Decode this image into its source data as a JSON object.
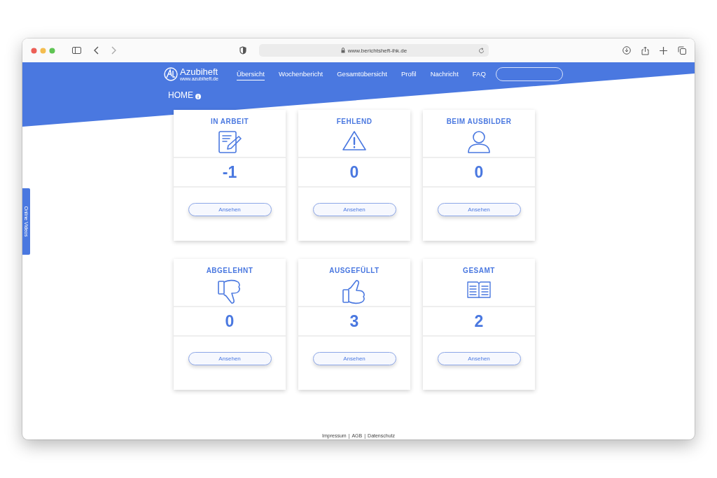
{
  "browser": {
    "url": "www.berichtsheft-ihk.de"
  },
  "header": {
    "logo_title": "Azubiheft",
    "logo_subtitle": "www.azubiheft.de",
    "nav": [
      {
        "label": "Übersicht",
        "selected": true
      },
      {
        "label": "Wochenbericht",
        "selected": false
      },
      {
        "label": "Gesamtübersicht",
        "selected": false
      },
      {
        "label": "Profil",
        "selected": false
      },
      {
        "label": "Nachricht",
        "selected": false
      },
      {
        "label": "FAQ",
        "selected": false
      }
    ],
    "page_title": "HOME"
  },
  "side_tab": {
    "label": "Online Videos"
  },
  "cards": [
    {
      "title": "IN ARBEIT",
      "kind": "edit",
      "count": "-1",
      "button": "Ansehen"
    },
    {
      "title": "FEHLEND",
      "kind": "warning",
      "count": "0",
      "button": "Ansehen"
    },
    {
      "title": "BEIM AUSBILDER",
      "kind": "person",
      "count": "0",
      "button": "Ansehen"
    },
    {
      "title": "ABGELEHNT",
      "kind": "thumbs-down",
      "count": "0",
      "button": "Ansehen"
    },
    {
      "title": "AUSGEFÜLLT",
      "kind": "thumbs-up",
      "count": "3",
      "button": "Ansehen"
    },
    {
      "title": "GESAMT",
      "kind": "book",
      "count": "2",
      "button": "Ansehen"
    }
  ],
  "footer": {
    "links": [
      "Impressum",
      "AGB",
      "Datenschutz"
    ],
    "separator": "|"
  }
}
